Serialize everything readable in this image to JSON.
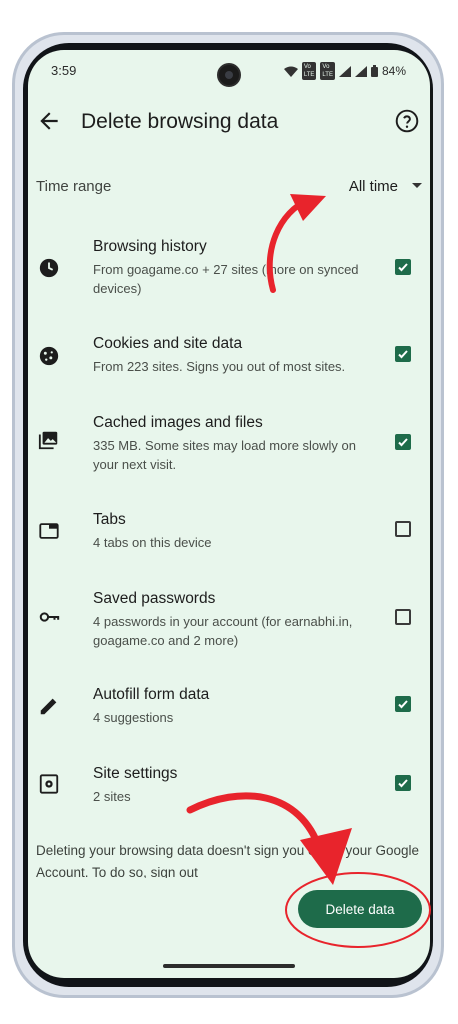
{
  "status_bar": {
    "time": "3:59",
    "battery": "84%"
  },
  "app_bar": {
    "title": "Delete browsing data"
  },
  "time_range": {
    "label": "Time range",
    "value": "All time"
  },
  "items": [
    {
      "title": "Browsing history",
      "subtitle": "From goagame.co + 27 sites (more on synced devices)",
      "checked": true,
      "icon": "clock-icon"
    },
    {
      "title": "Cookies and site data",
      "subtitle": "From 223 sites. Signs you out of most sites.",
      "checked": true,
      "icon": "cookie-icon"
    },
    {
      "title": "Cached images and files",
      "subtitle": "335 MB. Some sites may load more slowly on your next visit.",
      "checked": true,
      "icon": "image-icon"
    },
    {
      "title": "Tabs",
      "subtitle": "4 tabs on this device",
      "checked": false,
      "icon": "tab-icon"
    },
    {
      "title": "Saved passwords",
      "subtitle": "4 passwords in your account (for earnabhi.in, goagame.co and 2 more)",
      "checked": false,
      "icon": "key-icon"
    },
    {
      "title": "Autofill form data",
      "subtitle": "4 suggestions",
      "checked": true,
      "icon": "pencil-icon"
    },
    {
      "title": "Site settings",
      "subtitle": "2 sites",
      "checked": true,
      "icon": "site-settings-icon"
    }
  ],
  "footer_text": "Deleting your browsing data doesn't sign you out of your Google Account. To do so, sign out",
  "delete_button": "Delete data",
  "colors": {
    "background": "#e8f6ec",
    "accent": "#1e6b4a",
    "annotation": "#e8242c"
  }
}
